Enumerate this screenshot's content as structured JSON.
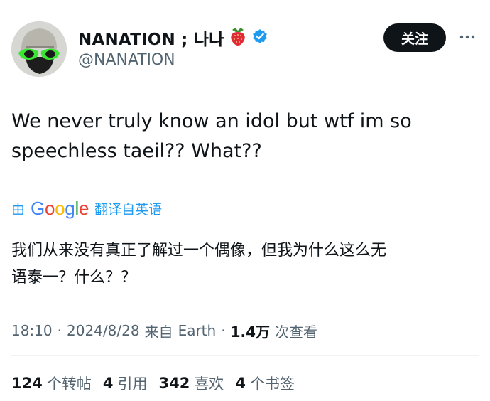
{
  "author": {
    "display_name": "NANATION ; 나나",
    "emoji_icon": "strawberry-icon",
    "verified_icon": "verified-badge-icon",
    "handle": "@NANATlON",
    "verified_color": "#1d9bf0"
  },
  "follow_button": {
    "label": "关注"
  },
  "more_icon": "more-dots-icon",
  "tweet": {
    "line1": "We never truly know an idol but wtf im so",
    "line2": "speechless taeil?? What??"
  },
  "translation": {
    "by_label": "由",
    "provider": "Google",
    "action_label": "翻译自英语",
    "line1": "我们从来没有真正了解过一个偶像，但我为什么这么无",
    "line2": "语泰一？什么？？"
  },
  "meta": {
    "time": "18:10",
    "sep1": "·",
    "date": "2024/8/28",
    "source_prefix": "来自",
    "source": "Earth",
    "sep2": "·",
    "views_count": "1.4万",
    "views_label": "次查看"
  },
  "stats": {
    "reposts_count": "124",
    "reposts_label": "个转帖",
    "quotes_count": "4",
    "quotes_label": "引用",
    "likes_count": "342",
    "likes_label": "喜欢",
    "bookmarks_count": "4",
    "bookmarks_label": "个书签"
  }
}
